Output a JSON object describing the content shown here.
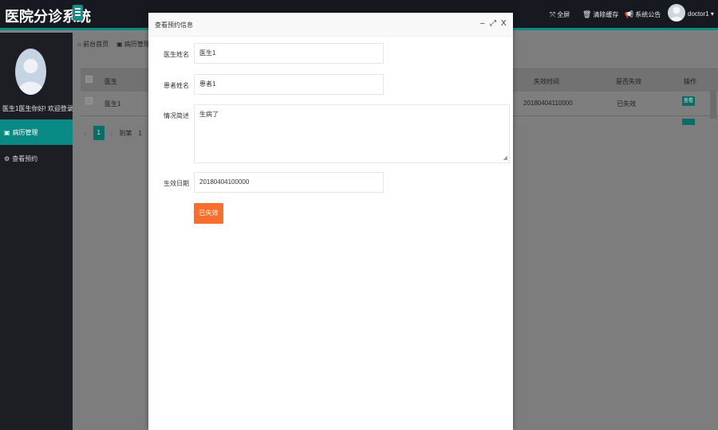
{
  "header": {
    "app_title": "医院分诊系统",
    "nav": [
      {
        "icon": "fullscreen-icon",
        "glyph": "⤧",
        "label": "全屏"
      },
      {
        "icon": "trash-icon",
        "glyph": "🗑",
        "label": "清除缓存"
      },
      {
        "icon": "megaphone-icon",
        "glyph": "📢",
        "label": "系统公告"
      }
    ],
    "username": "doctor1",
    "user_caret": "▾"
  },
  "sidebar": {
    "welcome": "医生1医生你好! 欢迎登录",
    "items": [
      {
        "icon": "record-icon",
        "glyph": "▣",
        "label": "病历管理",
        "active": true
      },
      {
        "icon": "gear-icon",
        "glyph": "⚙",
        "label": "查看预约",
        "active": false
      }
    ]
  },
  "background": {
    "breadcrumb": [
      {
        "glyph": "⌂",
        "label": "前台首页"
      },
      {
        "glyph": "▣",
        "label": "病历管理"
      }
    ],
    "table": {
      "headers": {
        "doctor": "医生",
        "fail_time": "失效时间",
        "expired": "是否失效",
        "action": "操作"
      },
      "row": {
        "doctor": "医生1",
        "fail_time": "20180404110000",
        "expired": "已失效",
        "action": "查看"
      }
    },
    "pager": {
      "page": "1",
      "goto": "到第",
      "page_input": "1"
    }
  },
  "modal": {
    "title": "查看预约信息",
    "controls": {
      "minimize": "–",
      "maximize": "⤢",
      "close": "X"
    },
    "fields": {
      "doctor_label": "医生姓名",
      "doctor_value": "医生1",
      "patient_label": "患者姓名",
      "patient_value": "患者1",
      "desc_label": "情况简述",
      "desc_value": "生病了",
      "date_label": "生效日期",
      "date_value": "20180404100000"
    },
    "status_button": "已失效"
  },
  "colors": {
    "accent": "#0a8a84",
    "header_bg": "#16191f",
    "sidebar_bg": "#1c1e24",
    "status_button": "#f86e2c"
  }
}
